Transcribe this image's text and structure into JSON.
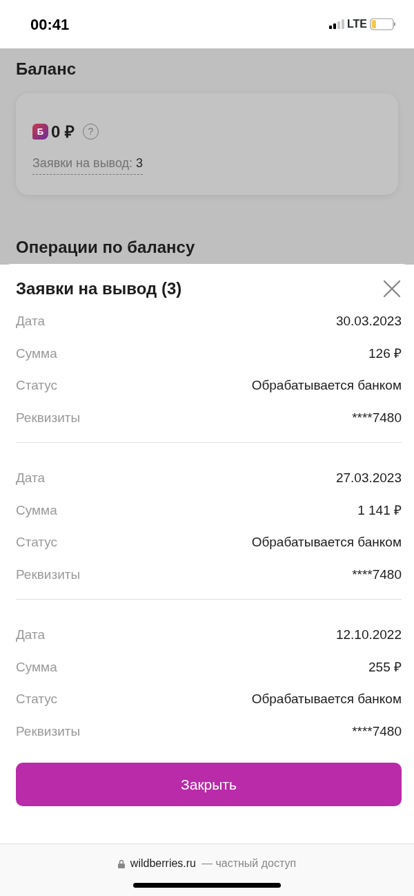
{
  "status_bar": {
    "time": "00:41",
    "network": "LTE"
  },
  "page": {
    "title": "Баланс",
    "balance": {
      "badge_letter": "Б",
      "amount": "0 ₽",
      "help": "?",
      "withdrawals_label": "Заявки на вывод:",
      "withdrawals_count": "3"
    },
    "operations_title": "Операции по балансу"
  },
  "sheet": {
    "title": "Заявки на вывод (3)",
    "requests": [
      {
        "fields": [
          {
            "label": "Дата",
            "value": "30.03.2023"
          },
          {
            "label": "Сумма",
            "value": "126 ₽"
          },
          {
            "label": "Статус",
            "value": "Обрабатывается банком"
          },
          {
            "label": "Реквизиты",
            "value": "****7480"
          }
        ]
      },
      {
        "fields": [
          {
            "label": "Дата",
            "value": "27.03.2023"
          },
          {
            "label": "Сумма",
            "value": "1 141 ₽"
          },
          {
            "label": "Статус",
            "value": "Обрабатывается банком"
          },
          {
            "label": "Реквизиты",
            "value": "****7480"
          }
        ]
      },
      {
        "fields": [
          {
            "label": "Дата",
            "value": "12.10.2022"
          },
          {
            "label": "Сумма",
            "value": "255 ₽"
          },
          {
            "label": "Статус",
            "value": "Обрабатывается банком"
          },
          {
            "label": "Реквизиты",
            "value": "****7480"
          }
        ]
      }
    ],
    "close_button": "Закрыть"
  },
  "browser_bar": {
    "domain": "wildberries.ru",
    "note": "— частный доступ"
  }
}
